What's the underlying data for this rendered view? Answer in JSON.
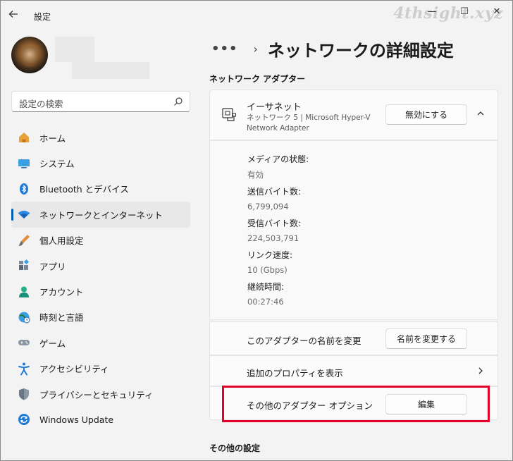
{
  "window": {
    "title": "設定",
    "watermark": "4thsight.xyz",
    "controls": {
      "minimize": "—",
      "maximize": "☐",
      "close": "✕"
    }
  },
  "search": {
    "placeholder": "設定の検索"
  },
  "nav": {
    "items": [
      {
        "label": "ホーム",
        "icon": "home-icon",
        "selected": false
      },
      {
        "label": "システム",
        "icon": "system-icon",
        "selected": false
      },
      {
        "label": "Bluetooth とデバイス",
        "icon": "bluetooth-icon",
        "selected": false
      },
      {
        "label": "ネットワークとインターネット",
        "icon": "wifi-icon",
        "selected": true
      },
      {
        "label": "個人用設定",
        "icon": "brush-icon",
        "selected": false
      },
      {
        "label": "アプリ",
        "icon": "apps-icon",
        "selected": false
      },
      {
        "label": "アカウント",
        "icon": "account-icon",
        "selected": false
      },
      {
        "label": "時刻と言語",
        "icon": "time-language-icon",
        "selected": false
      },
      {
        "label": "ゲーム",
        "icon": "gamepad-icon",
        "selected": false
      },
      {
        "label": "アクセシビリティ",
        "icon": "accessibility-icon",
        "selected": false
      },
      {
        "label": "プライバシーとセキュリティ",
        "icon": "shield-icon",
        "selected": false
      },
      {
        "label": "Windows Update",
        "icon": "update-icon",
        "selected": false
      }
    ]
  },
  "breadcrumb": {
    "dots": "•••",
    "separator": "›",
    "title": "ネットワークの詳細設定"
  },
  "section_adapters": "ネットワーク アダプター",
  "adapter": {
    "name": "イーサネット",
    "description": "ネットワーク 5 | Microsoft Hyper-V Network Adapter",
    "disable_button": "無効にする"
  },
  "details": {
    "media_state_label": "メディアの状態:",
    "media_state_value": "有効",
    "sent_label": "送信バイト数:",
    "sent_value": "6,799,094",
    "received_label": "受信バイト数:",
    "received_value": "224,503,791",
    "link_speed_label": "リンク速度:",
    "link_speed_value": "10 (Gbps)",
    "duration_label": "継続時間:",
    "duration_value": "00:27:46"
  },
  "rename": {
    "label": "このアダプターの名前を変更",
    "button": "名前を変更する"
  },
  "properties": {
    "label": "追加のプロパティを表示"
  },
  "options": {
    "label": "その他のアダプター オプション",
    "button": "編集"
  },
  "section_other": "その他の設定",
  "colors": {
    "accent": "#005fb8",
    "highlight": "#e4002b",
    "background": "#f3f3f3"
  }
}
